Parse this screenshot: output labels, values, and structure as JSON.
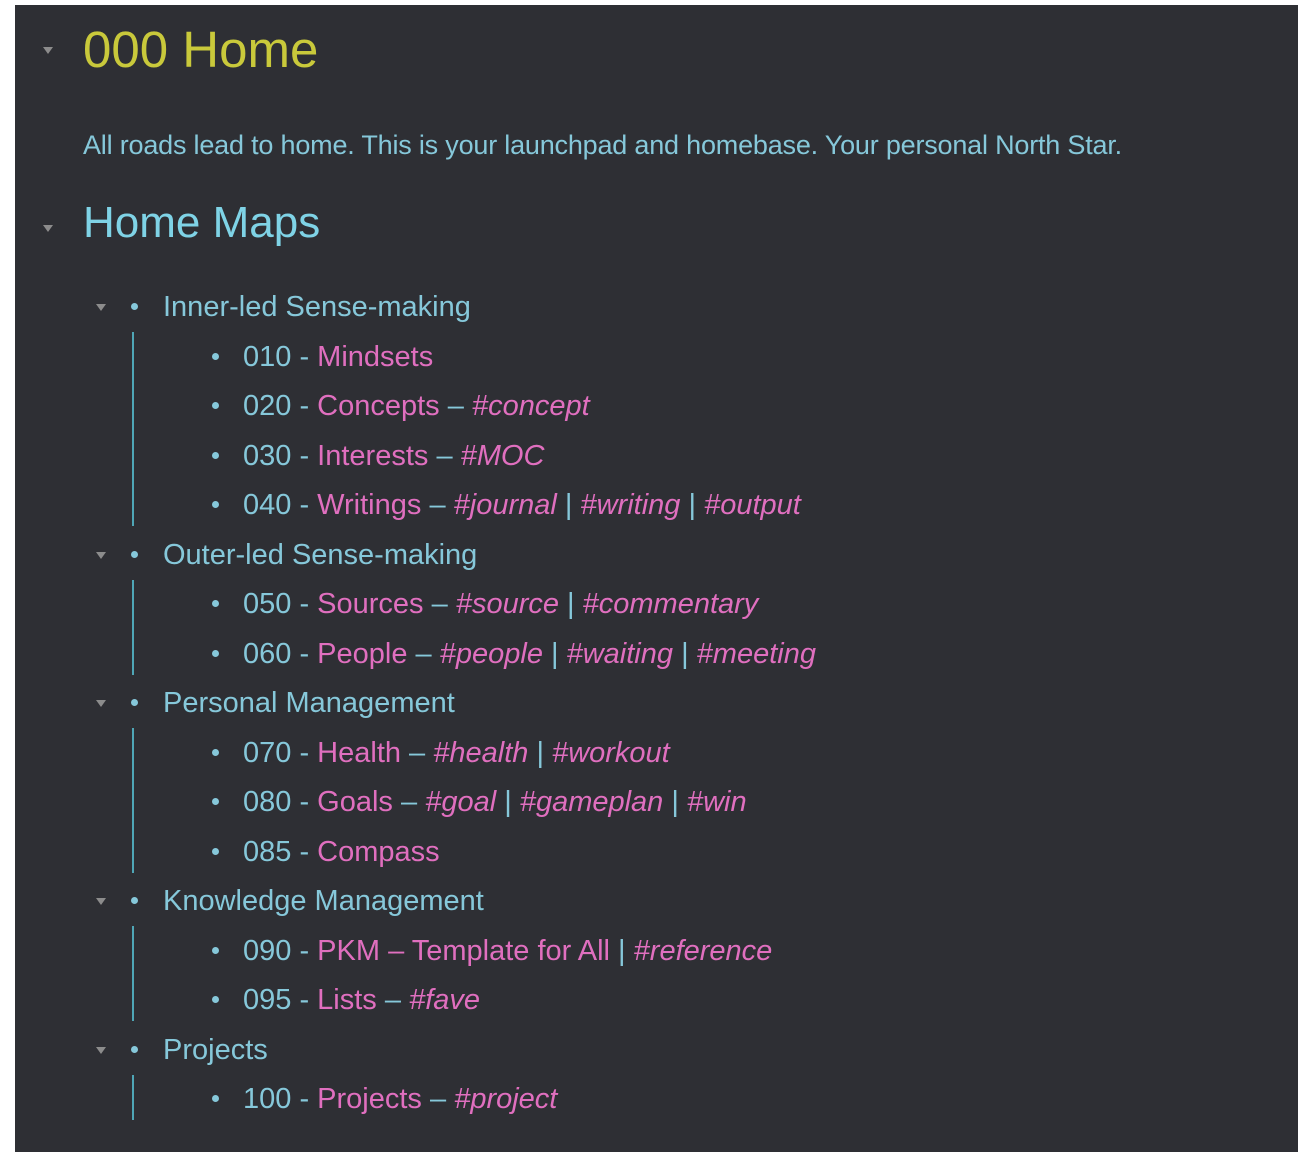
{
  "colors": {
    "background": "#2e2f34",
    "h1": "#c9c93b",
    "heading": "#7fd3e6",
    "text": "#86c8da",
    "link": "#e06fbf",
    "tag": "#e06fbf",
    "bullet": "#86c8da",
    "guide": "#4fa6b6",
    "collapse": "#8c8c8c"
  },
  "page": {
    "title": "000 Home",
    "intro": "All roads lead to home. This is your launchpad and homebase. Your personal North Star.",
    "section_title": "Home Maps"
  },
  "groups": [
    {
      "label": "Inner-led Sense-making",
      "items": [
        {
          "num": "010 - ",
          "link": "Mindsets",
          "sep": "",
          "tags": []
        },
        {
          "num": "020 - ",
          "link": "Concepts",
          "sep": " – ",
          "tags": [
            "#concept"
          ]
        },
        {
          "num": "030 - ",
          "link": "Interests",
          "sep": " – ",
          "tags": [
            "#MOC"
          ]
        },
        {
          "num": "040 - ",
          "link": "Writings",
          "sep": " – ",
          "tags": [
            "#journal",
            "#writing",
            "#output"
          ]
        }
      ]
    },
    {
      "label": "Outer-led Sense-making",
      "items": [
        {
          "num": "050 - ",
          "link": "Sources",
          "sep": " – ",
          "tags": [
            "#source",
            "#commentary"
          ]
        },
        {
          "num": "060 - ",
          "link": "People",
          "sep": " – ",
          "tags": [
            "#people",
            "#waiting",
            "#meeting"
          ]
        }
      ]
    },
    {
      "label": "Personal Management",
      "items": [
        {
          "num": "070 - ",
          "link": "Health",
          "sep": " – ",
          "tags": [
            "#health",
            "#workout"
          ]
        },
        {
          "num": "080 - ",
          "link": "Goals",
          "sep": " – ",
          "tags": [
            "#goal",
            "#gameplan",
            "#win"
          ]
        },
        {
          "num": "085 - ",
          "link": "Compass",
          "sep": "",
          "tags": []
        }
      ]
    },
    {
      "label": "Knowledge Management",
      "items": [
        {
          "num": "090 - ",
          "link": "PKM – Template for All",
          "sep": " | ",
          "tags": [
            "#reference"
          ]
        },
        {
          "num": "095 - ",
          "link": "Lists",
          "sep": " – ",
          "tags": [
            "#fave"
          ]
        }
      ]
    },
    {
      "label": "Projects",
      "items": [
        {
          "num": "100 - ",
          "link": "Projects",
          "sep": " – ",
          "tags": [
            "#project"
          ]
        }
      ]
    }
  ]
}
